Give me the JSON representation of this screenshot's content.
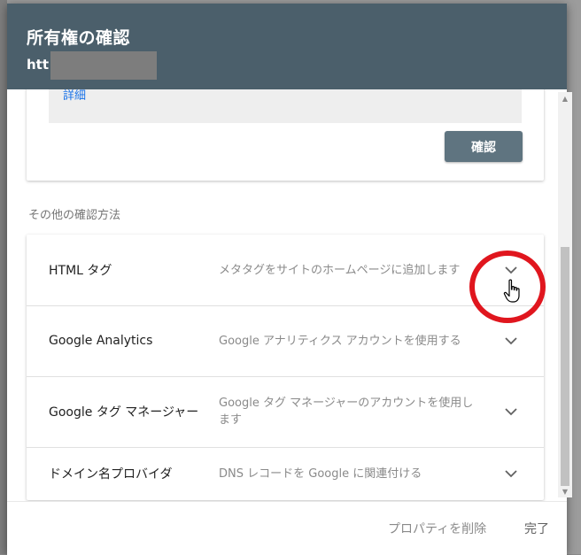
{
  "dialog": {
    "title": "所有権の確認",
    "url_prefix": "htt"
  },
  "top_card": {
    "detail_link": "詳細",
    "verify_button": "確認"
  },
  "other_methods_label": "その他の確認方法",
  "methods": [
    {
      "name": "HTML タグ",
      "description": "メタタグをサイトのホームページに追加します"
    },
    {
      "name": "Google Analytics",
      "description": "Google アナリティクス アカウントを使用する"
    },
    {
      "name": "Google タグ マネージャー",
      "description": "Google タグ マネージャーのアカウントを使用します"
    },
    {
      "name": "ドメイン名プロバイダ",
      "description": "DNS レコードを Google に関連付ける"
    }
  ],
  "footer": {
    "delete_property": "プロパティを削除",
    "done": "完了"
  },
  "colors": {
    "header_bg": "#4b5f6b",
    "verify_button_bg": "#5f7480",
    "link": "#1a73e8",
    "highlight_circle": "#e0161e"
  },
  "icons": {
    "chevron": "chevron-down-icon",
    "cursor": "hand-pointer-icon"
  }
}
